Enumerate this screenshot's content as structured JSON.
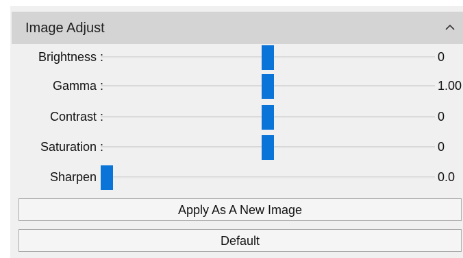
{
  "panel": {
    "title": "Image Adjust",
    "collapse_icon": "chevron-up-icon"
  },
  "sliders": [
    {
      "label": "Brightness :",
      "value": "0",
      "position_fraction": 0.5
    },
    {
      "label": "Gamma :",
      "value": "1.00",
      "position_fraction": 0.5
    },
    {
      "label": "Contrast :",
      "value": "0",
      "position_fraction": 0.5
    },
    {
      "label": "Saturation :",
      "value": "0",
      "position_fraction": 0.5
    },
    {
      "label": "Sharpen :",
      "value": "0.0",
      "position_fraction": 0.0
    }
  ],
  "buttons": {
    "apply_new_label": "Apply As A New Image",
    "default_label": "Default"
  },
  "colors": {
    "slider_thumb": "#0a74d8",
    "header_bg": "#d4d4d4",
    "panel_bg": "#f0f0f0"
  }
}
